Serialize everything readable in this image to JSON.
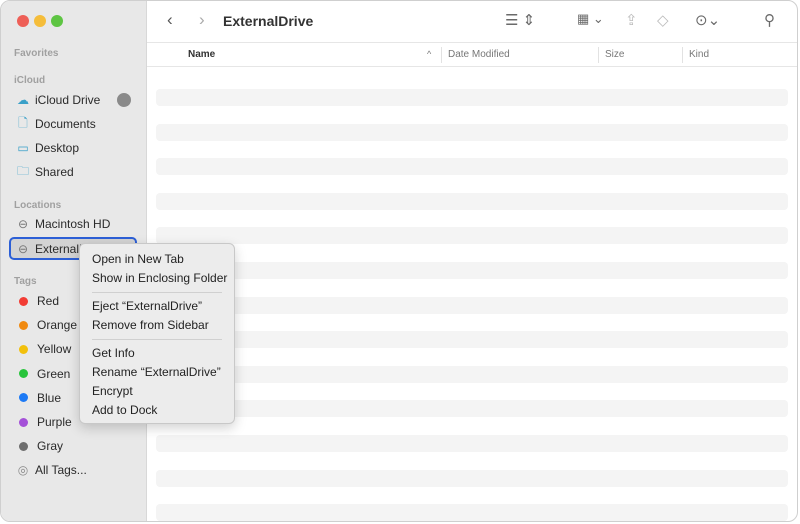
{
  "window": {
    "title": "ExternalDrive"
  },
  "sidebar": {
    "favorites": "Favorites",
    "icloud": {
      "label": "iCloud",
      "items": [
        {
          "label": "iCloud Drive",
          "icon": "cloud-icon"
        },
        {
          "label": "Documents",
          "icon": "document-icon"
        },
        {
          "label": "Desktop",
          "icon": "desktop-icon"
        },
        {
          "label": "Shared",
          "icon": "shared-folder-icon"
        }
      ]
    },
    "locations": {
      "label": "Locations",
      "items": [
        {
          "label": "Macintosh HD",
          "icon": "disk-icon"
        },
        {
          "label": "ExternalDrive",
          "icon": "disk-icon",
          "selected": true
        }
      ]
    },
    "tags": {
      "label": "Tags",
      "items": [
        {
          "label": "Red",
          "color": "#f23c34"
        },
        {
          "label": "Orange",
          "color": "#f08a10"
        },
        {
          "label": "Yellow",
          "color": "#f2c00c"
        },
        {
          "label": "Green",
          "color": "#28c43c"
        },
        {
          "label": "Blue",
          "color": "#1d7af5"
        },
        {
          "label": "Purple",
          "color": "#a450d8"
        },
        {
          "label": "Gray",
          "color": "#6e6e6e"
        }
      ],
      "all": "All Tags..."
    }
  },
  "columns": [
    "Name",
    "Date Modified",
    "Size",
    "Kind"
  ],
  "context_menu": {
    "groups": [
      [
        "Open in New Tab",
        "Show in Enclosing Folder"
      ],
      [
        "Eject “ExternalDrive”",
        "Remove from Sidebar"
      ],
      [
        "Get Info",
        "Rename “ExternalDrive”",
        "Encrypt",
        "Add to Dock"
      ]
    ]
  }
}
